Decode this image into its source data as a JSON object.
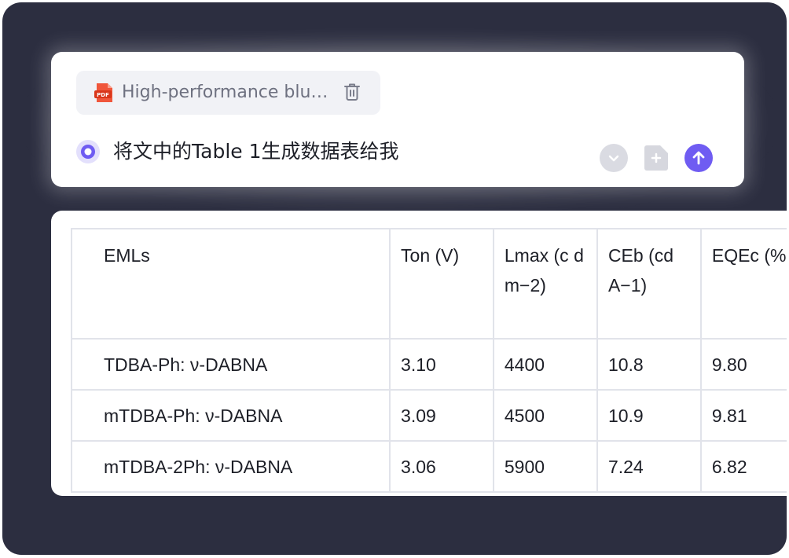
{
  "composer": {
    "attachment": {
      "type_label": "PDF",
      "file_name": "High-performance blu…"
    },
    "prompt": "将文中的Table 1生成数据表给我",
    "accent_color": "#6f5cf2"
  },
  "table": {
    "headers": [
      "EMLs",
      "Ton (V)",
      "Lmax (c d m−2)",
      "CEb (cd A−1)",
      "EQEc (%"
    ],
    "rows": [
      [
        "TDBA-Ph: ν-DABNA",
        "3.10",
        "4400",
        "10.8",
        "9.80"
      ],
      [
        "mTDBA-Ph: ν-DABNA",
        "3.09",
        "4500",
        "10.9",
        "9.81"
      ],
      [
        "mTDBA-2Ph: ν-DABNA",
        "3.06",
        "5900",
        "7.24",
        "6.82"
      ]
    ]
  }
}
